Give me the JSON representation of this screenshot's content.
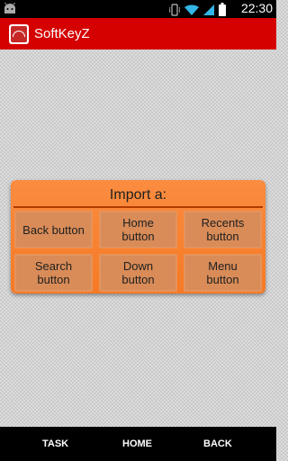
{
  "status_bar": {
    "time": "22:30",
    "icons": [
      "android-icon",
      "vibrate-icon",
      "wifi-icon",
      "signal-icon",
      "battery-icon"
    ]
  },
  "action_bar": {
    "title": "SoftKeyZ",
    "color": "#d50000",
    "icon": "softkeyz-app-icon"
  },
  "dialog": {
    "title": "Import a:",
    "color": "#f57a25",
    "buttons": [
      {
        "label": "Back button"
      },
      {
        "label": "Home\nbutton"
      },
      {
        "label": "Recents\nbutton"
      },
      {
        "label": "Search\nbutton"
      },
      {
        "label": "Down\nbutton"
      },
      {
        "label": "Menu\nbutton"
      }
    ]
  },
  "nav_bar": {
    "task_label": "TASK",
    "home_label": "HOME",
    "back_label": "BACK"
  }
}
